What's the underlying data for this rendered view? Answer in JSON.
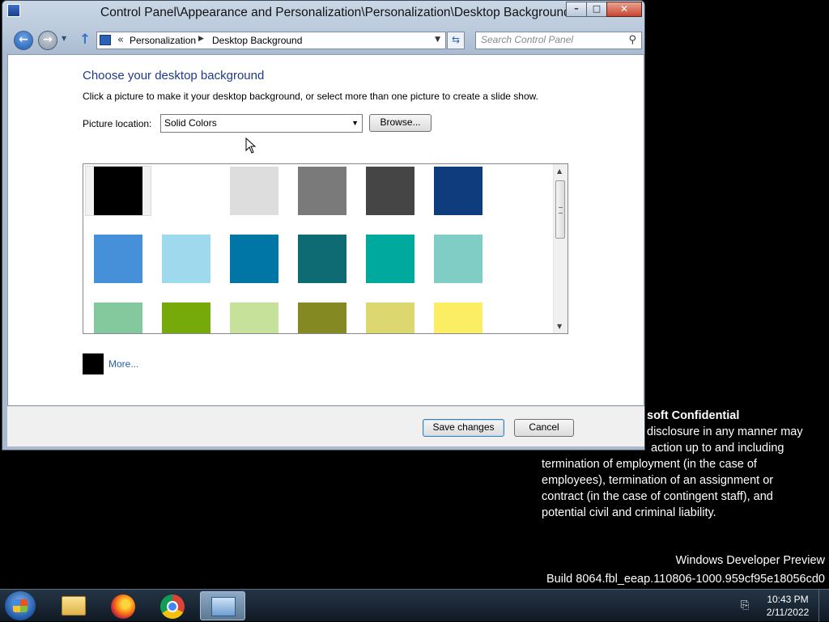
{
  "window": {
    "title": "Control Panel\\Appearance and Personalization\\Personalization\\Desktop Background",
    "caption_buttons": {
      "minimize": "–",
      "maximize": "□",
      "close": "✕"
    }
  },
  "nav": {
    "back_glyph": "←",
    "forward_glyph": "→",
    "up_glyph": "↑"
  },
  "address": {
    "prefix": "«",
    "crumbs": [
      "Personalization",
      "Desktop Background"
    ],
    "separator": "▶"
  },
  "search": {
    "placeholder": "Search Control Panel"
  },
  "main": {
    "heading": "Choose your desktop background",
    "description": "Click a picture to make it your desktop background, or select more than one picture to create a slide show.",
    "location_label": "Picture location:",
    "location_value": "Solid Colors",
    "browse_label": "Browse...",
    "more_label": "More...",
    "selected_color": "#000000",
    "colors": [
      [
        "#000000",
        "#ffffff",
        "#dddddd",
        "#7a7a7a",
        "#454545",
        "#0e3c7d"
      ],
      [
        "#4590d8",
        "#9fd9ee",
        "#0076a7",
        "#0f6b73",
        "#00a99d",
        "#80cdc6"
      ],
      [
        "#84c99d",
        "#76a90a",
        "#c6e19a",
        "#848a21",
        "#dcd76f",
        "#fcee64"
      ]
    ]
  },
  "footer": {
    "save_label": "Save changes",
    "cancel_label": "Cancel"
  },
  "desktop": {
    "confidential_title": "soft Confidential",
    "confidential_lines": [
      "disclosure in any manner may",
      "action up to and including",
      "termination of employment (in the case of",
      "employees), termination of an assignment or",
      "contract (in the case of contingent staff), and",
      "potential civil and criminal liability."
    ],
    "build_line1": "Windows Developer Preview",
    "build_line2": "Build 8064.fbl_eeap.110806-1000.959cf95e18056cd0"
  },
  "taskbar": {
    "items": [
      "start-icon",
      "file-explorer-icon",
      "firefox-icon",
      "chrome-icon",
      "control-panel-icon"
    ],
    "active_item": "control-panel-icon",
    "time": "10:43 PM",
    "date": "2/11/2022"
  }
}
